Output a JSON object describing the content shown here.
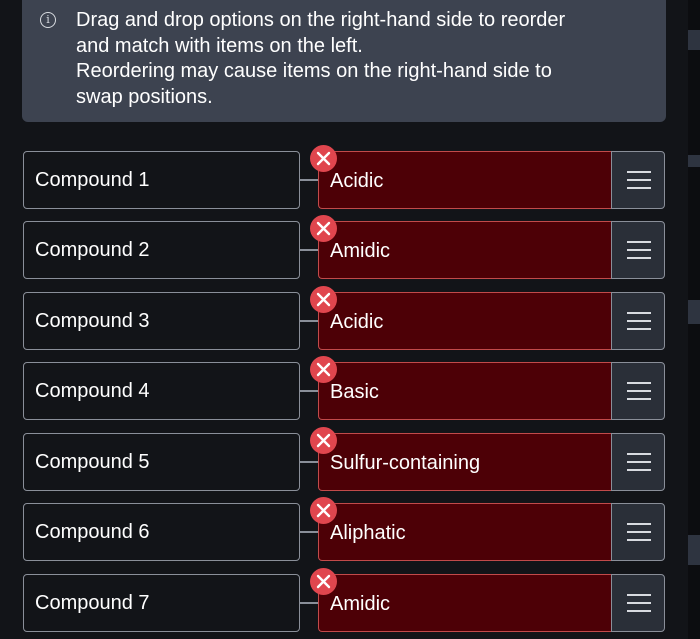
{
  "instructions": {
    "icon": "info-icon",
    "lines": [
      "Drag and drop options on the right-hand side to reorder",
      "and match with items on the left.",
      "Reordering may cause items on the right-hand side to",
      "swap positions."
    ]
  },
  "pairs": [
    {
      "left": "Compound 1",
      "right": "Acidic",
      "status": "incorrect"
    },
    {
      "left": "Compound 2",
      "right": "Amidic",
      "status": "incorrect"
    },
    {
      "left": "Compound 3",
      "right": "Acidic",
      "status": "incorrect"
    },
    {
      "left": "Compound 4",
      "right": "Basic",
      "status": "incorrect"
    },
    {
      "left": "Compound 5",
      "right": "Sulfur-containing",
      "status": "incorrect"
    },
    {
      "left": "Compound 6",
      "right": "Aliphatic",
      "status": "incorrect"
    },
    {
      "left": "Compound 7",
      "right": "Amidic",
      "status": "incorrect"
    }
  ],
  "icons": {
    "status": "x-mark-icon",
    "drag": "drag-handle-icon"
  },
  "colors": {
    "background": "#121418",
    "info_box": "#3d4350",
    "incorrect_fill": "#4d0006",
    "incorrect_border": "#c24a4a",
    "error_badge": "#e0464e",
    "border": "#8a8f99"
  }
}
